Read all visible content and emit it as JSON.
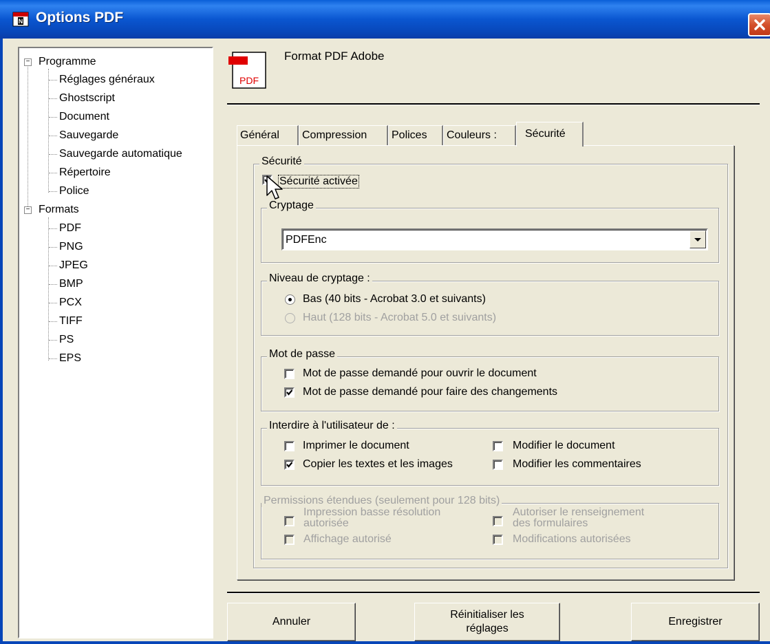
{
  "window": {
    "title": "Options PDF"
  },
  "tree": {
    "groups": [
      {
        "label": "Programme",
        "items": [
          "Réglages généraux",
          "Ghostscript",
          "Document",
          "Sauvegarde",
          "Sauvegarde automatique",
          "Répertoire",
          "Police"
        ]
      },
      {
        "label": "Formats",
        "items": [
          "PDF",
          "PNG",
          "JPEG",
          "BMP",
          "PCX",
          "TIFF",
          "PS",
          "EPS"
        ]
      }
    ]
  },
  "header": {
    "format_title": "Format PDF Adobe",
    "icon_text": "PDF"
  },
  "tabs": [
    "Général",
    "Compression",
    "Polices",
    "Couleurs :",
    "Sécurité"
  ],
  "active_tab": "Sécurité",
  "security": {
    "group_label": "Sécurité",
    "enable_label": "Sécurité activée",
    "enable_checked": true,
    "encryption": {
      "label": "Cryptage",
      "value": "PDFEnc"
    },
    "level": {
      "label": "Niveau de cryptage :",
      "options": [
        "Bas (40 bits - Acrobat 3.0 et suivants)",
        "Haut (128 bits - Acrobat 5.0 et suivants)"
      ],
      "selected": 0
    },
    "password": {
      "label": "Mot de passe",
      "open_label": "Mot de passe demandé pour ouvrir le document",
      "open_checked": false,
      "change_label": "Mot de passe demandé pour faire des changements",
      "change_checked": true
    },
    "restrict": {
      "label": "Interdire à l'utilisateur de :",
      "print_label": "Imprimer le document",
      "print_checked": false,
      "modify_label": "Modifier le document",
      "modify_checked": false,
      "copy_label": "Copier les textes et les images",
      "copy_checked": true,
      "comments_label": "Modifier les commentaires",
      "comments_checked": false
    },
    "extended": {
      "label": "Permissions étendues (seulement pour 128 bits)",
      "lowres_label_1": "Impression basse résolution",
      "lowres_label_2": "autorisée",
      "forms_label_1": "Autoriser le renseignement",
      "forms_label_2": "des formulaires",
      "view_label": "Affichage autorisé",
      "modif_label": "Modifications autorisées"
    }
  },
  "buttons": {
    "cancel": "Annuler",
    "reset_line1": "Réinitialiser les",
    "reset_line2": "réglages",
    "save": "Enregistrer"
  }
}
